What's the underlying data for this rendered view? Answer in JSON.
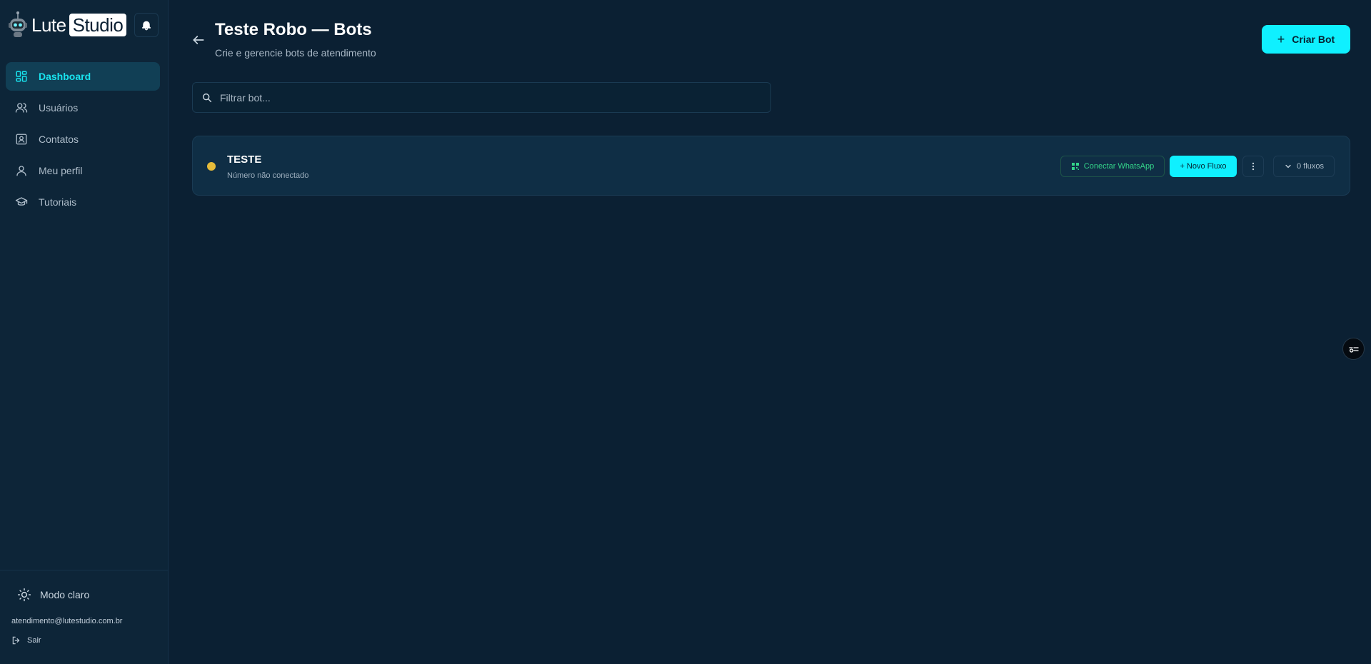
{
  "brand": {
    "part1": "Lute",
    "part2": "Studio"
  },
  "sidebar": {
    "items": [
      {
        "label": "Dashboard",
        "icon": "dashboard-icon",
        "active": true
      },
      {
        "label": "Usuários",
        "icon": "users-icon",
        "active": false
      },
      {
        "label": "Contatos",
        "icon": "contacts-icon",
        "active": false
      },
      {
        "label": "Meu perfil",
        "icon": "user-icon",
        "active": false
      },
      {
        "label": "Tutoriais",
        "icon": "graduation-cap-icon",
        "active": false
      }
    ],
    "theme_toggle_label": "Modo claro",
    "user_email": "atendimento@lutestudio.com.br",
    "logout_label": "Sair"
  },
  "header": {
    "title": "Teste Robo — Bots",
    "subtitle": "Crie e gerencie bots de atendimento",
    "create_label": "Criar Bot"
  },
  "search": {
    "placeholder": "Filtrar bot..."
  },
  "bots": [
    {
      "name": "TESTE",
      "status_text": "Número não conectado",
      "status_color": "#e5bb3a",
      "connect_label": "Conectar WhatsApp",
      "new_flow_label": "+ Novo Fluxo",
      "flows_label": "0 fluxos"
    }
  ],
  "colors": {
    "accent": "#0ff0ff",
    "background": "#0b2033",
    "sidebar": "#0d2538",
    "whatsapp": "#34d58a"
  }
}
